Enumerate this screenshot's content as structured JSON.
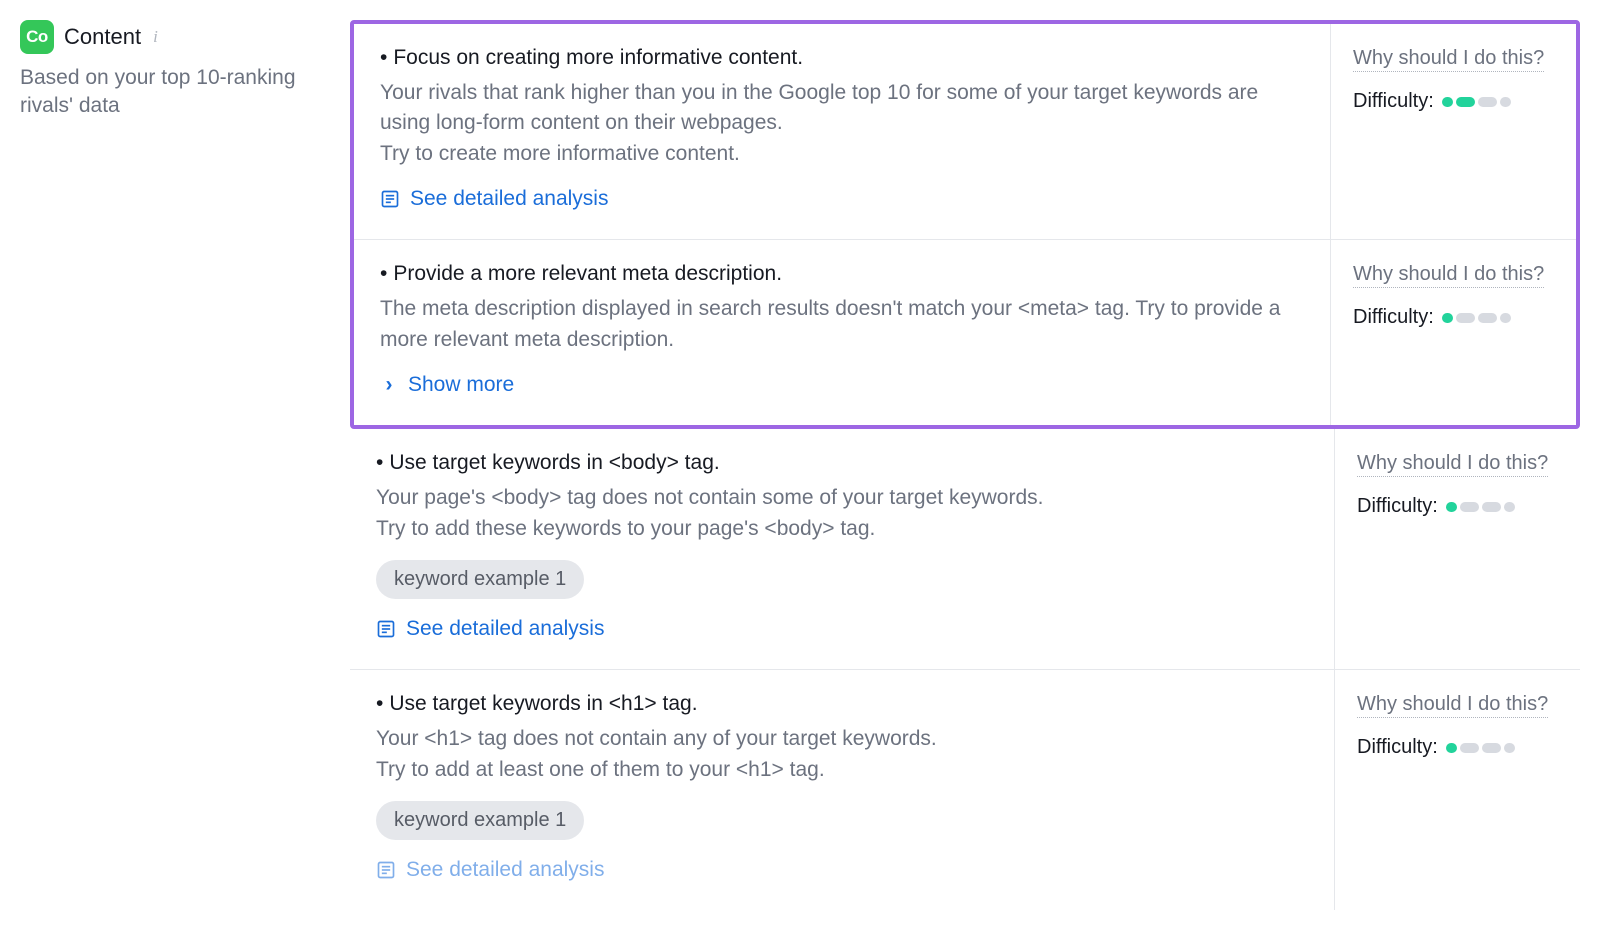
{
  "sidebar": {
    "badge": "Co",
    "title": "Content",
    "subtitle": "Based on your top 10-ranking rivals' data"
  },
  "labels": {
    "why": "Why should I do this?",
    "difficulty": "Difficulty:",
    "see_analysis": "See detailed analysis",
    "show_more": "Show more"
  },
  "items": [
    {
      "title": "Focus on creating more informative content.",
      "desc": "Your rivals that rank higher than you in the Google top 10 for some of your target keywords are using long-form content on their webpages.\nTry to create more informative content.",
      "action": "analysis",
      "chips": [],
      "difficulty": 2,
      "highlighted": true,
      "faded": false
    },
    {
      "title": "Provide a more relevant meta description.",
      "desc": "The meta description displayed in search results doesn't match your <meta> tag. Try to provide a more relevant meta description.",
      "action": "showmore",
      "chips": [],
      "difficulty": 1,
      "highlighted": true,
      "faded": false
    },
    {
      "title": "Use target keywords in <body> tag.",
      "desc": "Your page's <body> tag does not contain some of your target keywords.\nTry to add these keywords to your page's <body> tag.",
      "action": "analysis",
      "chips": [
        "keyword example 1"
      ],
      "difficulty": 1,
      "highlighted": false,
      "faded": false
    },
    {
      "title": "Use target keywords in <h1> tag.",
      "desc": "Your <h1> tag does not contain any of your target keywords.\nTry to add at least one of them to your <h1> tag.",
      "action": "analysis",
      "chips": [
        "keyword example 1"
      ],
      "difficulty": 1,
      "highlighted": false,
      "faded": true
    }
  ]
}
